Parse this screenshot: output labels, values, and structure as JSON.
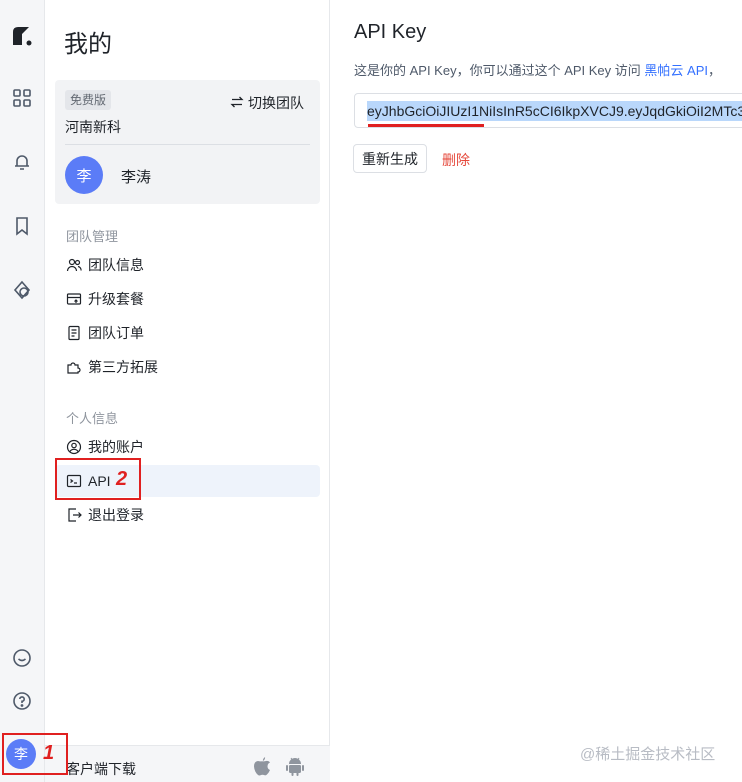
{
  "rail": {
    "logo": "app-logo-icon",
    "items": [
      "grid-icon",
      "bell-icon",
      "bookmark-icon",
      "shapes-icon"
    ],
    "bottom": [
      "chat-icon",
      "help-icon"
    ],
    "avatar_initial": "李"
  },
  "sidebar": {
    "title": "我的",
    "team": {
      "plan_badge": "免费版",
      "name": "河南新科",
      "switch_label": "切换团队",
      "user_initial": "李",
      "user_name": "李涛"
    },
    "team_section_label": "团队管理",
    "team_items": [
      {
        "label": "团队信息",
        "icon": "team-icon"
      },
      {
        "label": "升级套餐",
        "icon": "upgrade-icon"
      },
      {
        "label": "团队订单",
        "icon": "order-icon"
      },
      {
        "label": "第三方拓展",
        "icon": "extension-icon"
      }
    ],
    "personal_section_label": "个人信息",
    "personal_items": [
      {
        "label": "我的账户",
        "icon": "user-circle-icon"
      },
      {
        "label": "API",
        "icon": "terminal-icon"
      },
      {
        "label": "退出登录",
        "icon": "logout-icon"
      }
    ],
    "download_label": "客户端下载"
  },
  "annotations": {
    "one": "1",
    "two": "2",
    "color": "#e02020"
  },
  "main": {
    "title": "API Key",
    "desc_prefix": "这是你的 API Key，你可以通过这个 API Key 访问",
    "desc_link": "黑帕云 API",
    "desc_suffix": "，",
    "api_key": "eyJhbGciOiJIUzI1NiIsInR5cCI6IkpXVCJ9.eyJqdGkiOiI2MTc3",
    "regenerate_label": "重新生成",
    "delete_label": "删除"
  },
  "watermark": "@稀土掘金技术社区",
  "colors": {
    "accent": "#3370ff",
    "avatar": "#5b7cf7",
    "danger": "#e5483b",
    "selection": "#b9d7fb"
  }
}
